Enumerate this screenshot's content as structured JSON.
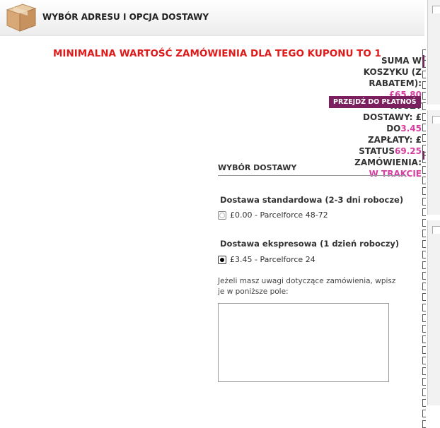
{
  "header": {
    "title": "WYBÓR ADRESU I OPCJA DOSTAWY",
    "icon": "box-icon"
  },
  "warning": {
    "text": "MINIMALNA WARTOŚĆ ZAMÓWIENIA DLA TEGO KUPONU TO 1"
  },
  "summary": {
    "line1": "SUMA W",
    "line2": "KOSZYKU (Z",
    "line3": "RABATEM):",
    "cart_total": "£65.80",
    "pay_button": "PRZEJDŹ DO PŁATNOŚ",
    "line4": "KOSZT",
    "line5": "DOSTAWY: £",
    "line6": "DO",
    "shipping_cost": "3.45",
    "line7": "ZAPŁATY: £",
    "line8": "STATUS",
    "to_pay": "69.25",
    "line9": "ZAMÓWIENIA:",
    "status_value": "W TRAKCIE"
  },
  "delivery": {
    "heading": "WYBÓR DOSTAWY",
    "options": [
      {
        "title": "Dostawa standardowa (2-3 dni robocze)",
        "price": "£0.00",
        "carrier": "Parcelforce 48-72",
        "selected": false
      },
      {
        "title": "Dostawa ekspresowa (1 dzień roboczy)",
        "price": "£3.45",
        "carrier": "Parcelforce 24",
        "selected": true
      }
    ],
    "note_label": "Jeżeli masz uwagi dotyczące zamówienia, wpisz je w poniższe pole:",
    "note_value": ""
  },
  "colors": {
    "accent_pink": "#d63fa1",
    "button_purple": "#7b1f5e",
    "warning_red": "#e01a1a"
  }
}
